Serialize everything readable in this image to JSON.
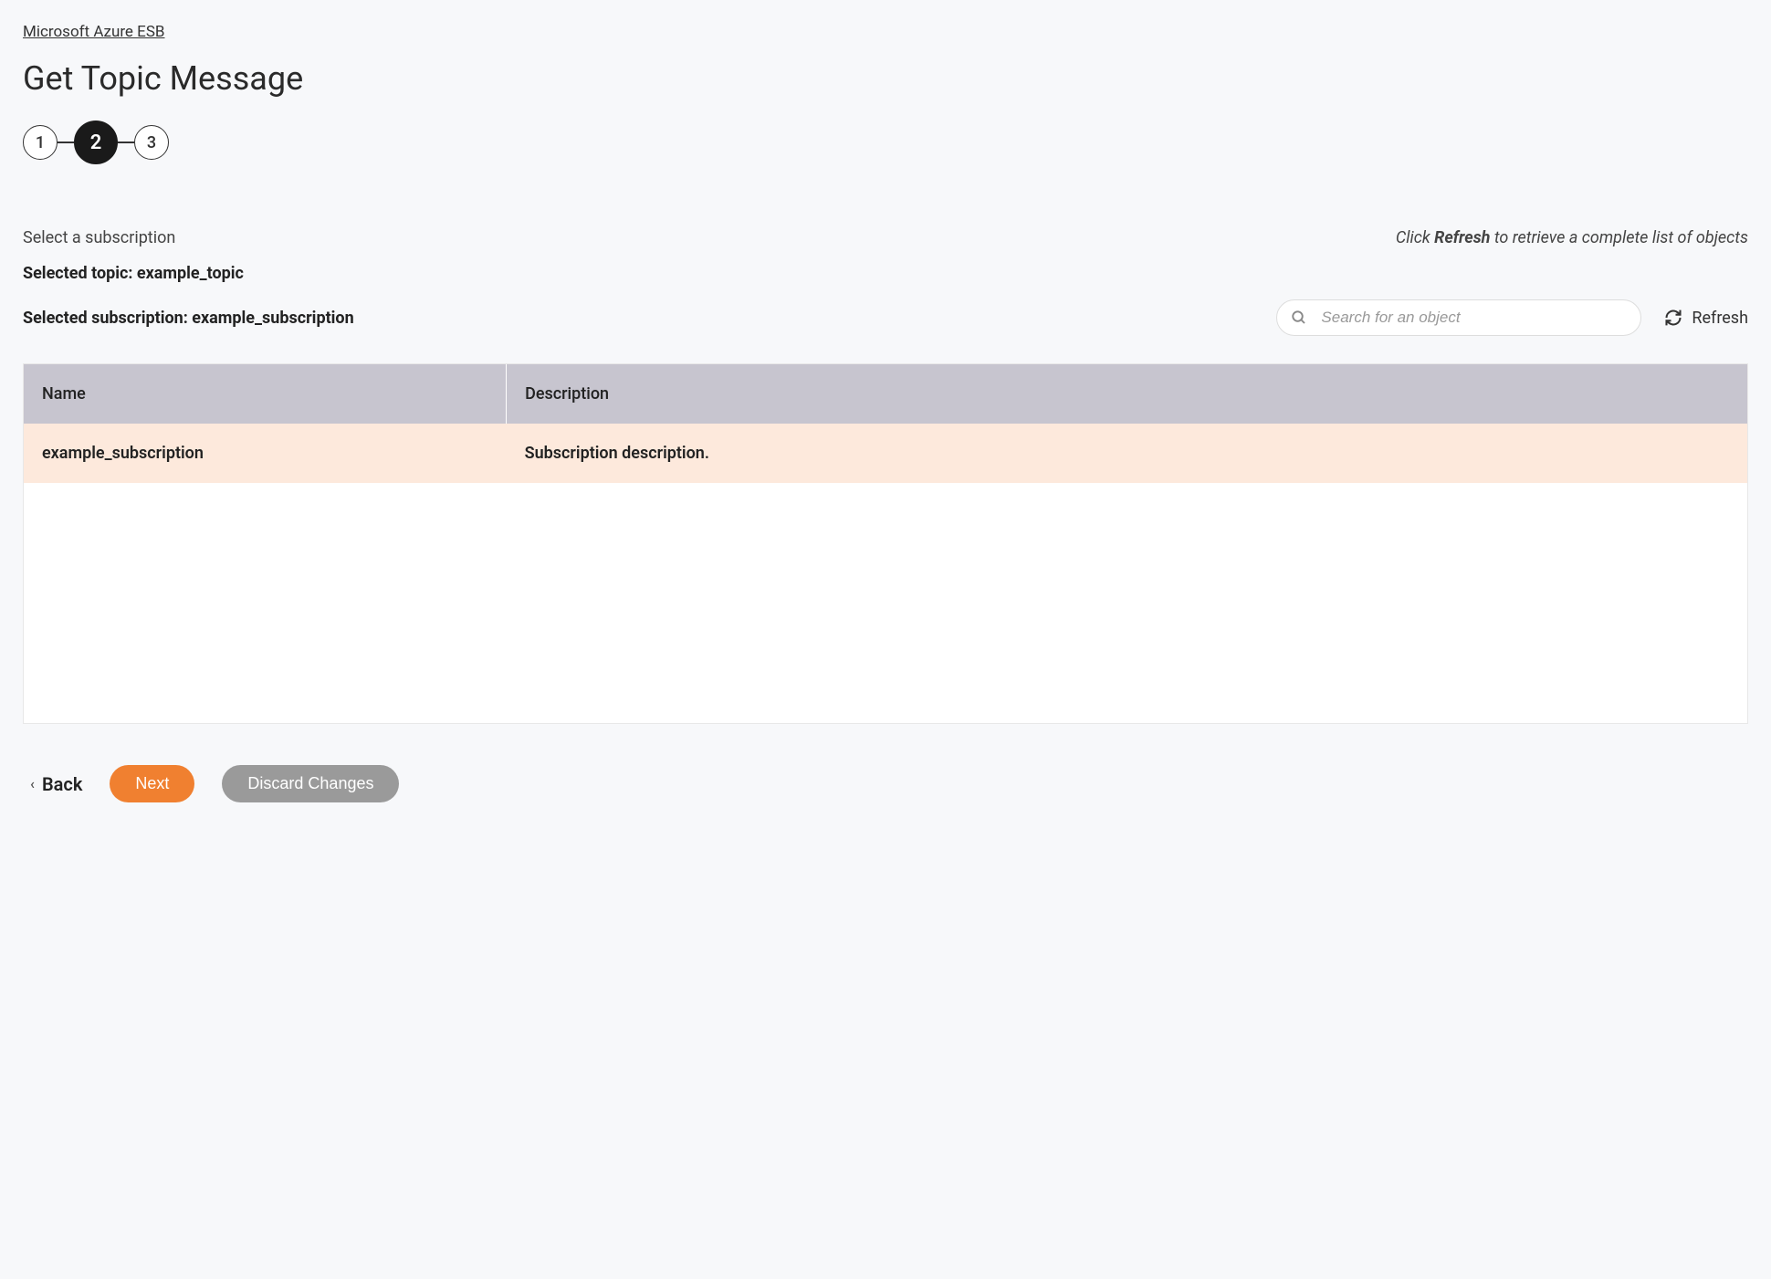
{
  "breadcrumb": {
    "label": "Microsoft Azure ESB"
  },
  "page": {
    "title": "Get Topic Message"
  },
  "stepper": {
    "steps": [
      "1",
      "2",
      "3"
    ],
    "active_index": 1
  },
  "main": {
    "instruction": "Select a subscription",
    "refresh_hint_prefix": "Click ",
    "refresh_hint_bold": "Refresh",
    "refresh_hint_suffix": " to retrieve a complete list of objects",
    "selected_topic_label": "Selected topic: ",
    "selected_topic_value": "example_topic",
    "selected_subscription_label": "Selected subscription: ",
    "selected_subscription_value": "example_subscription"
  },
  "search": {
    "placeholder": "Search for an object",
    "value": ""
  },
  "refresh": {
    "label": "Refresh"
  },
  "table": {
    "headers": {
      "name": "Name",
      "description": "Description"
    },
    "rows": [
      {
        "name": "example_subscription",
        "description": "Subscription description."
      }
    ]
  },
  "footer": {
    "back": "Back",
    "next": "Next",
    "discard": "Discard Changes"
  }
}
